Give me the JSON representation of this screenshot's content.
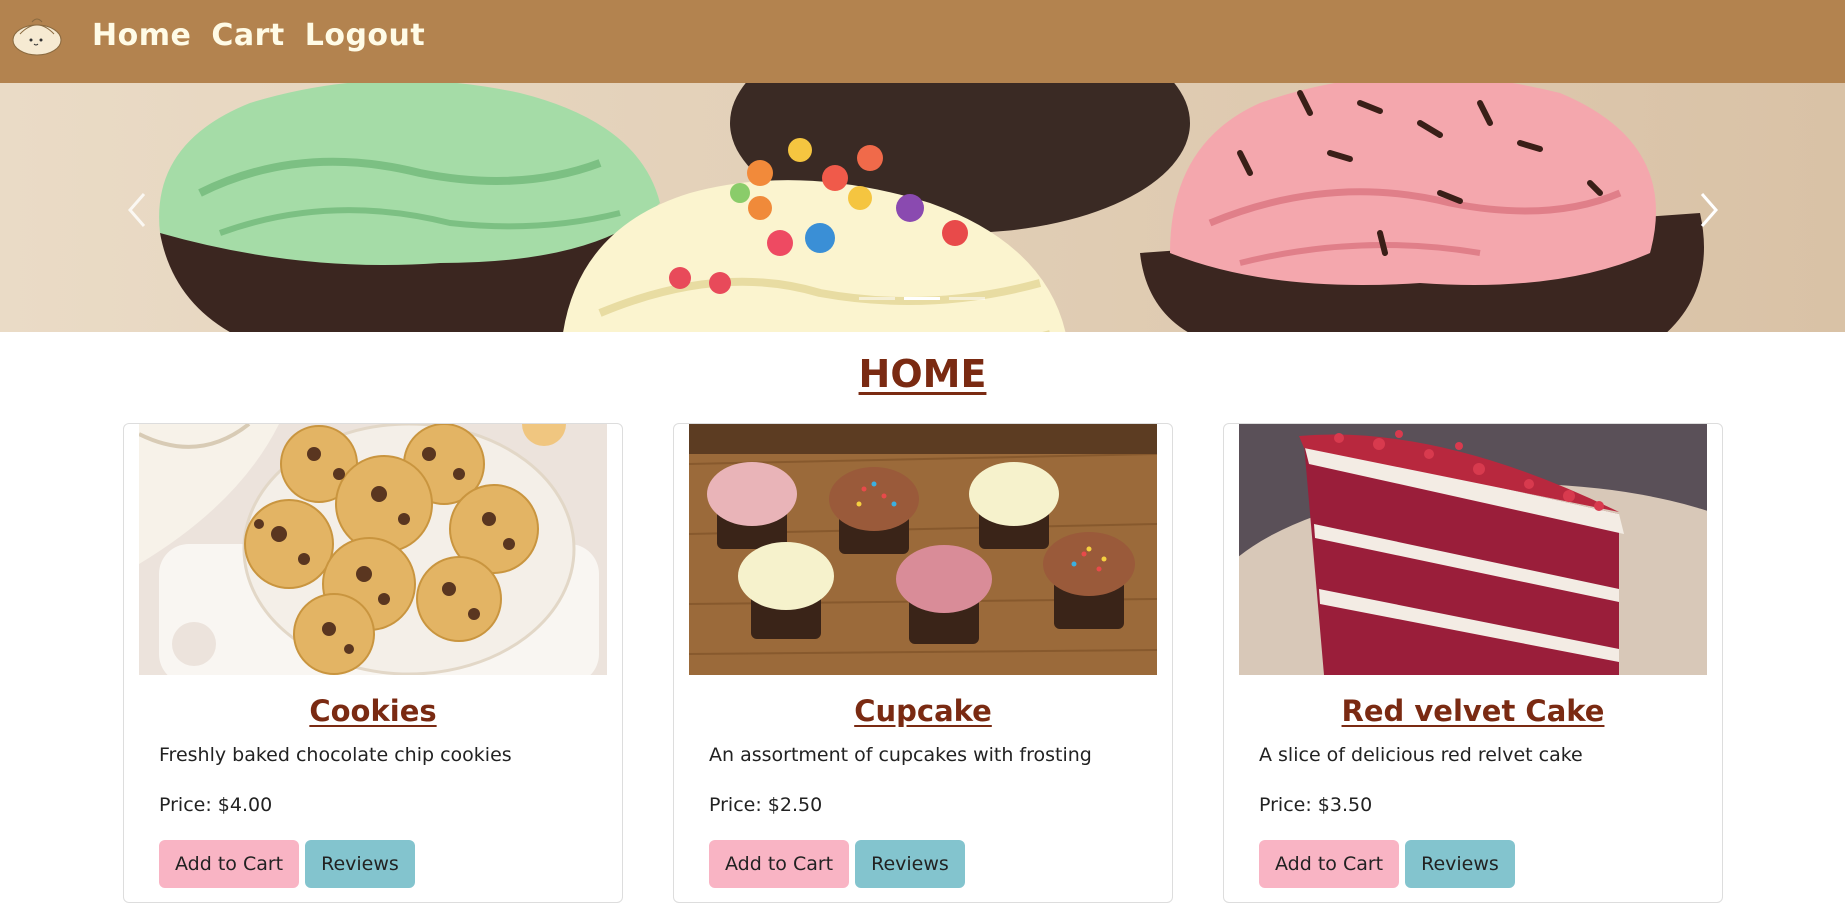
{
  "nav": {
    "links": [
      "Home",
      "Cart",
      "Logout"
    ]
  },
  "carousel": {
    "slide_count": 3,
    "active_slide": 2
  },
  "page_title": "HOME",
  "products": [
    {
      "name": "Cookies",
      "description": "Freshly baked chocolate chip cookies",
      "price": "Price: $4.00",
      "add_label": "Add to Cart",
      "reviews_label": "Reviews"
    },
    {
      "name": "Cupcake",
      "description": "An assortment of cupcakes with frosting",
      "price": "Price: $2.50",
      "add_label": "Add to Cart",
      "reviews_label": "Reviews"
    },
    {
      "name": "Red velvet Cake",
      "description": "A slice of delicious red relvet cake",
      "price": "Price: $3.50",
      "add_label": "Add to Cart",
      "reviews_label": "Reviews"
    }
  ],
  "colors": {
    "navbar": "#b3834f",
    "title": "#7a2a12",
    "add_button": "#f9b4c4",
    "reviews_button": "#83c4ce"
  }
}
